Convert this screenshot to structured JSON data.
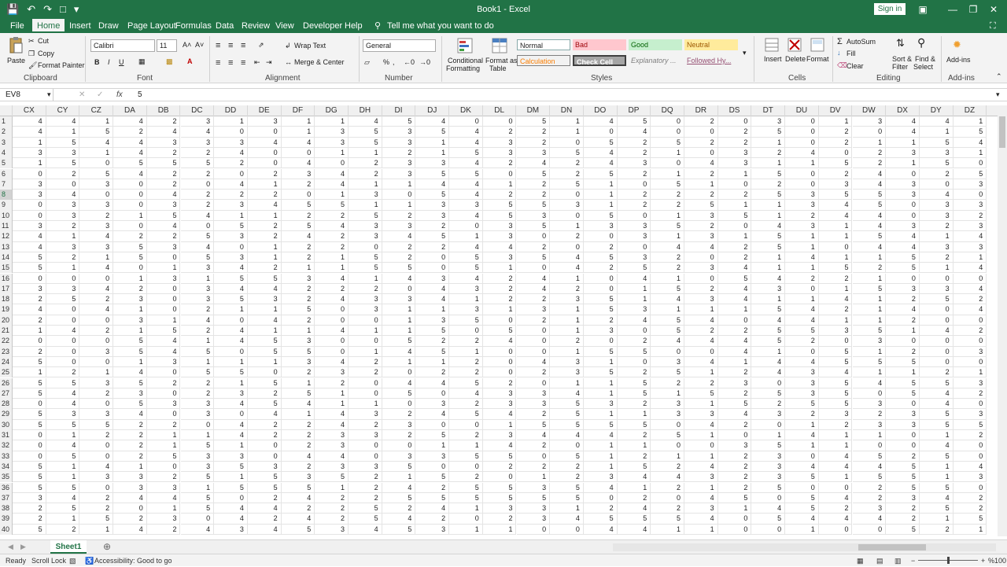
{
  "titlebar": {
    "title": "Book1 - Excel",
    "signin": "Sign in",
    "bg": "#217346"
  },
  "menu": {
    "file": "File",
    "home": "Home",
    "insert": "Insert",
    "draw": "Draw",
    "page_layout": "Page Layout",
    "formulas": "Formulas",
    "data": "Data",
    "review": "Review",
    "view": "View",
    "developer": "Developer",
    "help": "Help",
    "tell_me": "Tell me what you want to do"
  },
  "ribbon": {
    "clipboard": {
      "label": "Clipboard",
      "paste": "Paste",
      "cut": "Cut",
      "copy": "Copy",
      "format_painter": "Format Painter"
    },
    "font": {
      "label": "Font",
      "name": "Calibri",
      "size": "11",
      "bold": "B",
      "italic": "I",
      "underline": "U"
    },
    "alignment": {
      "label": "Alignment",
      "wrap": "Wrap Text",
      "merge": "Merge & Center"
    },
    "number": {
      "label": "Number",
      "format": "General"
    },
    "styles": {
      "label": "Styles",
      "cond": "Conditional",
      "cond2": "Formatting",
      "fmt_table": "Format as",
      "fmt_table2": "Table",
      "normal": "Normal",
      "bad": "Bad",
      "good": "Good",
      "neutral": "Neutral",
      "calculation": "Calculation",
      "check_cell": "Check Cell",
      "explanatory": "Explanatory ...",
      "followed": "Followed Hy..."
    },
    "cells": {
      "label": "Cells",
      "insert": "Insert",
      "delete": "Delete",
      "format": "Format"
    },
    "editing": {
      "label": "Editing",
      "autosum": "AutoSum",
      "fill": "Fill",
      "clear": "Clear",
      "sort": "Sort &",
      "sort2": "Filter",
      "find": "Find &",
      "find2": "Select"
    },
    "addins": {
      "label": "Add-ins",
      "button": "Add-ins"
    }
  },
  "formula_bar": {
    "name_box": "EV8",
    "fx": "fx",
    "value": "5"
  },
  "sheet": {
    "columns": [
      "CX",
      "CY",
      "CZ",
      "DA",
      "DB",
      "DC",
      "DD",
      "DE",
      "DF",
      "DG",
      "DH",
      "DI",
      "DJ",
      "DK",
      "DL",
      "DM",
      "DN",
      "DO",
      "DP",
      "DQ",
      "DR",
      "DS",
      "DT",
      "DU",
      "DV",
      "DW",
      "DX",
      "DY",
      "DZ"
    ],
    "rows": [
      {
        "n": "1",
        "v": [
          4,
          4,
          1,
          4,
          2,
          3,
          1,
          3,
          1,
          1,
          4,
          5,
          4,
          0,
          0,
          5,
          1,
          4,
          5,
          0,
          2,
          0,
          3,
          0,
          1,
          3,
          4,
          4,
          1
        ]
      },
      {
        "n": "2",
        "v": [
          4,
          1,
          5,
          2,
          4,
          4,
          0,
          0,
          1,
          3,
          5,
          3,
          5,
          4,
          2,
          2,
          1,
          0,
          4,
          0,
          0,
          2,
          5,
          0,
          2,
          0,
          4,
          1,
          5
        ]
      },
      {
        "n": "3",
        "v": [
          1,
          5,
          4,
          4,
          3,
          3,
          3,
          4,
          4,
          3,
          5,
          3,
          1,
          4,
          3,
          2,
          0,
          5,
          2,
          5,
          2,
          2,
          1,
          0,
          2,
          1,
          1,
          5,
          4
        ]
      },
      {
        "n": "4",
        "v": [
          3,
          3,
          1,
          4,
          2,
          2,
          4,
          0,
          0,
          1,
          1,
          2,
          1,
          5,
          3,
          3,
          5,
          4,
          2,
          1,
          0,
          3,
          2,
          4,
          0,
          2,
          3,
          3,
          1
        ]
      },
      {
        "n": "5",
        "v": [
          1,
          5,
          0,
          5,
          5,
          5,
          2,
          0,
          4,
          0,
          2,
          3,
          3,
          4,
          2,
          4,
          2,
          4,
          3,
          0,
          4,
          3,
          1,
          1,
          5,
          2,
          1,
          5,
          0
        ]
      },
      {
        "n": "6",
        "v": [
          0,
          2,
          5,
          4,
          2,
          2,
          0,
          2,
          3,
          4,
          2,
          3,
          5,
          5,
          0,
          5,
          2,
          5,
          2,
          1,
          2,
          1,
          5,
          0,
          2,
          4,
          0,
          2,
          5
        ]
      },
      {
        "n": "7",
        "v": [
          3,
          0,
          3,
          0,
          2,
          0,
          4,
          1,
          2,
          4,
          1,
          1,
          4,
          4,
          1,
          2,
          5,
          1,
          0,
          5,
          1,
          0,
          2,
          0,
          3,
          4,
          3,
          0,
          3
        ]
      },
      {
        "n": "8",
        "v": [
          3,
          4,
          0,
          0,
          4,
          2,
          2,
          2,
          0,
          1,
          3,
          0,
          5,
          4,
          2,
          2,
          0,
          1,
          2,
          2,
          2,
          2,
          5,
          3,
          5,
          5,
          3,
          4,
          0
        ]
      },
      {
        "n": "9",
        "v": [
          0,
          3,
          3,
          0,
          3,
          2,
          3,
          4,
          5,
          5,
          1,
          1,
          3,
          3,
          5,
          5,
          3,
          1,
          2,
          2,
          5,
          1,
          1,
          3,
          4,
          5,
          0,
          3,
          3
        ]
      },
      {
        "n": "10",
        "v": [
          0,
          3,
          2,
          1,
          5,
          4,
          1,
          1,
          2,
          2,
          5,
          2,
          3,
          4,
          5,
          3,
          0,
          5,
          0,
          1,
          3,
          5,
          1,
          2,
          4,
          4,
          0,
          3,
          2
        ]
      },
      {
        "n": "11",
        "v": [
          3,
          2,
          3,
          0,
          4,
          0,
          5,
          2,
          5,
          4,
          3,
          3,
          2,
          0,
          3,
          5,
          1,
          3,
          3,
          5,
          2,
          0,
          4,
          3,
          1,
          4,
          3,
          2,
          3
        ]
      },
      {
        "n": "12",
        "v": [
          4,
          1,
          4,
          2,
          2,
          5,
          3,
          2,
          4,
          2,
          3,
          4,
          5,
          1,
          3,
          0,
          2,
          0,
          3,
          1,
          3,
          1,
          5,
          1,
          1,
          5,
          4,
          1,
          4
        ]
      },
      {
        "n": "13",
        "v": [
          4,
          3,
          3,
          5,
          3,
          4,
          0,
          1,
          2,
          2,
          0,
          2,
          2,
          4,
          4,
          2,
          0,
          2,
          0,
          4,
          4,
          2,
          5,
          1,
          0,
          4,
          4,
          3,
          3
        ]
      },
      {
        "n": "14",
        "v": [
          5,
          2,
          1,
          5,
          0,
          5,
          3,
          1,
          2,
          1,
          5,
          2,
          0,
          5,
          3,
          5,
          4,
          5,
          3,
          2,
          0,
          2,
          1,
          4,
          1,
          1,
          5,
          2,
          1
        ]
      },
      {
        "n": "15",
        "v": [
          5,
          1,
          4,
          0,
          1,
          3,
          4,
          2,
          1,
          1,
          5,
          5,
          0,
          5,
          1,
          0,
          4,
          2,
          5,
          2,
          3,
          4,
          1,
          1,
          5,
          2,
          5,
          1,
          4
        ]
      },
      {
        "n": "16",
        "v": [
          0,
          0,
          0,
          1,
          3,
          1,
          5,
          5,
          3,
          4,
          1,
          4,
          3,
          4,
          2,
          4,
          1,
          0,
          4,
          1,
          0,
          5,
          4,
          2,
          2,
          1,
          0,
          0,
          0
        ]
      },
      {
        "n": "17",
        "v": [
          3,
          3,
          4,
          2,
          0,
          3,
          4,
          4,
          2,
          2,
          2,
          0,
          4,
          3,
          2,
          4,
          2,
          0,
          1,
          5,
          2,
          4,
          3,
          0,
          1,
          5,
          3,
          3,
          4
        ]
      },
      {
        "n": "18",
        "v": [
          2,
          5,
          2,
          3,
          0,
          3,
          5,
          3,
          2,
          4,
          3,
          3,
          4,
          1,
          2,
          2,
          3,
          5,
          1,
          4,
          3,
          4,
          1,
          1,
          4,
          1,
          2,
          5,
          2
        ]
      },
      {
        "n": "19",
        "v": [
          4,
          0,
          4,
          1,
          0,
          2,
          1,
          1,
          5,
          0,
          3,
          1,
          1,
          3,
          1,
          3,
          1,
          5,
          3,
          1,
          1,
          1,
          5,
          4,
          2,
          1,
          4,
          0,
          4
        ]
      },
      {
        "n": "20",
        "v": [
          2,
          0,
          0,
          3,
          1,
          4,
          0,
          4,
          2,
          0,
          0,
          1,
          3,
          5,
          0,
          2,
          1,
          2,
          4,
          5,
          4,
          0,
          4,
          4,
          1,
          1,
          2,
          0,
          0
        ]
      },
      {
        "n": "21",
        "v": [
          1,
          4,
          2,
          1,
          5,
          2,
          4,
          1,
          1,
          4,
          1,
          1,
          5,
          0,
          5,
          0,
          1,
          3,
          0,
          5,
          2,
          2,
          5,
          5,
          3,
          5,
          1,
          4,
          2
        ]
      },
      {
        "n": "22",
        "v": [
          0,
          0,
          0,
          5,
          4,
          1,
          4,
          5,
          3,
          0,
          0,
          5,
          2,
          2,
          4,
          0,
          2,
          0,
          2,
          4,
          4,
          4,
          5,
          2,
          0,
          3,
          0,
          0,
          0
        ]
      },
      {
        "n": "23",
        "v": [
          2,
          0,
          3,
          5,
          4,
          5,
          0,
          5,
          5,
          0,
          1,
          4,
          5,
          1,
          0,
          0,
          1,
          5,
          5,
          0,
          0,
          4,
          1,
          0,
          5,
          1,
          2,
          0,
          3
        ]
      },
      {
        "n": "24",
        "v": [
          5,
          0,
          0,
          1,
          3,
          1,
          1,
          1,
          3,
          4,
          2,
          1,
          1,
          2,
          0,
          4,
          3,
          1,
          0,
          3,
          4,
          1,
          4,
          4,
          5,
          5,
          5,
          0,
          0
        ]
      },
      {
        "n": "25",
        "v": [
          1,
          2,
          1,
          4,
          0,
          5,
          5,
          0,
          2,
          3,
          2,
          0,
          2,
          2,
          0,
          2,
          3,
          5,
          2,
          5,
          1,
          2,
          4,
          3,
          4,
          1,
          1,
          2,
          1
        ]
      },
      {
        "n": "26",
        "v": [
          5,
          5,
          3,
          5,
          2,
          2,
          1,
          5,
          1,
          2,
          0,
          4,
          4,
          5,
          2,
          0,
          1,
          1,
          5,
          2,
          2,
          3,
          0,
          3,
          5,
          4,
          5,
          5,
          3
        ]
      },
      {
        "n": "27",
        "v": [
          5,
          4,
          2,
          3,
          0,
          2,
          3,
          2,
          5,
          1,
          0,
          5,
          0,
          4,
          3,
          3,
          4,
          1,
          5,
          1,
          5,
          2,
          5,
          3,
          5,
          0,
          5,
          4,
          2
        ]
      },
      {
        "n": "28",
        "v": [
          0,
          4,
          0,
          5,
          3,
          3,
          4,
          5,
          4,
          1,
          1,
          0,
          3,
          2,
          3,
          3,
          5,
          3,
          2,
          3,
          1,
          5,
          2,
          5,
          5,
          3,
          0,
          4,
          0
        ]
      },
      {
        "n": "29",
        "v": [
          5,
          3,
          3,
          4,
          0,
          3,
          0,
          4,
          1,
          4,
          3,
          2,
          4,
          5,
          4,
          2,
          5,
          1,
          1,
          3,
          3,
          4,
          3,
          2,
          3,
          2,
          3,
          5,
          3
        ]
      },
      {
        "n": "30",
        "v": [
          5,
          5,
          5,
          2,
          2,
          0,
          4,
          2,
          2,
          4,
          2,
          3,
          0,
          0,
          1,
          5,
          5,
          5,
          5,
          0,
          4,
          2,
          0,
          1,
          2,
          3,
          3,
          5,
          5
        ]
      },
      {
        "n": "31",
        "v": [
          0,
          1,
          2,
          2,
          1,
          1,
          4,
          2,
          2,
          3,
          3,
          2,
          5,
          2,
          3,
          4,
          4,
          4,
          2,
          5,
          1,
          0,
          1,
          4,
          1,
          1,
          0,
          1,
          2
        ]
      },
      {
        "n": "32",
        "v": [
          0,
          4,
          0,
          2,
          1,
          5,
          1,
          0,
          2,
          3,
          0,
          0,
          1,
          1,
          4,
          2,
          0,
          1,
          1,
          0,
          0,
          3,
          5,
          1,
          1,
          0,
          0,
          4,
          0
        ]
      },
      {
        "n": "33",
        "v": [
          0,
          5,
          0,
          2,
          5,
          3,
          3,
          0,
          4,
          4,
          0,
          3,
          3,
          5,
          5,
          0,
          5,
          1,
          2,
          1,
          1,
          2,
          3,
          0,
          4,
          5,
          2,
          5,
          0
        ]
      },
      {
        "n": "34",
        "v": [
          5,
          1,
          4,
          1,
          0,
          3,
          5,
          3,
          2,
          3,
          3,
          5,
          0,
          0,
          2,
          2,
          2,
          1,
          5,
          2,
          4,
          2,
          3,
          4,
          4,
          4,
          5,
          1,
          4
        ]
      },
      {
        "n": "35",
        "v": [
          5,
          1,
          3,
          3,
          2,
          5,
          1,
          5,
          3,
          5,
          2,
          1,
          5,
          2,
          0,
          1,
          2,
          3,
          4,
          4,
          3,
          2,
          3,
          5,
          1,
          5,
          5,
          1,
          3
        ]
      },
      {
        "n": "36",
        "v": [
          5,
          5,
          0,
          3,
          3,
          1,
          5,
          5,
          5,
          1,
          2,
          4,
          2,
          5,
          5,
          3,
          5,
          4,
          1,
          2,
          1,
          2,
          5,
          0,
          0,
          2,
          5,
          5,
          0
        ]
      },
      {
        "n": "37",
        "v": [
          3,
          4,
          2,
          4,
          4,
          5,
          0,
          2,
          4,
          2,
          2,
          5,
          5,
          5,
          5,
          5,
          5,
          0,
          2,
          0,
          4,
          5,
          0,
          5,
          4,
          2,
          3,
          4,
          2
        ]
      },
      {
        "n": "38",
        "v": [
          2,
          5,
          2,
          0,
          1,
          5,
          4,
          4,
          2,
          2,
          5,
          2,
          4,
          1,
          3,
          3,
          1,
          2,
          4,
          2,
          3,
          1,
          4,
          5,
          2,
          3,
          2,
          5,
          2
        ]
      },
      {
        "n": "39",
        "v": [
          2,
          1,
          5,
          2,
          3,
          0,
          4,
          2,
          4,
          2,
          5,
          4,
          2,
          0,
          2,
          3,
          4,
          5,
          5,
          5,
          4,
          0,
          5,
          4,
          4,
          4,
          2,
          1,
          5
        ]
      },
      {
        "n": "40",
        "v": [
          5,
          2,
          1,
          4,
          2,
          4,
          3,
          4,
          5,
          3,
          4,
          5,
          3,
          1,
          1,
          0,
          0,
          4,
          4,
          1,
          1,
          0,
          0,
          1,
          0,
          0,
          5,
          2,
          1
        ]
      }
    ]
  },
  "sheet_tab": "Sheet1",
  "status": {
    "ready": "Ready",
    "scroll_lock": "Scroll Lock",
    "accessibility": "Accessibility: Good to go",
    "zoom": "%100"
  }
}
